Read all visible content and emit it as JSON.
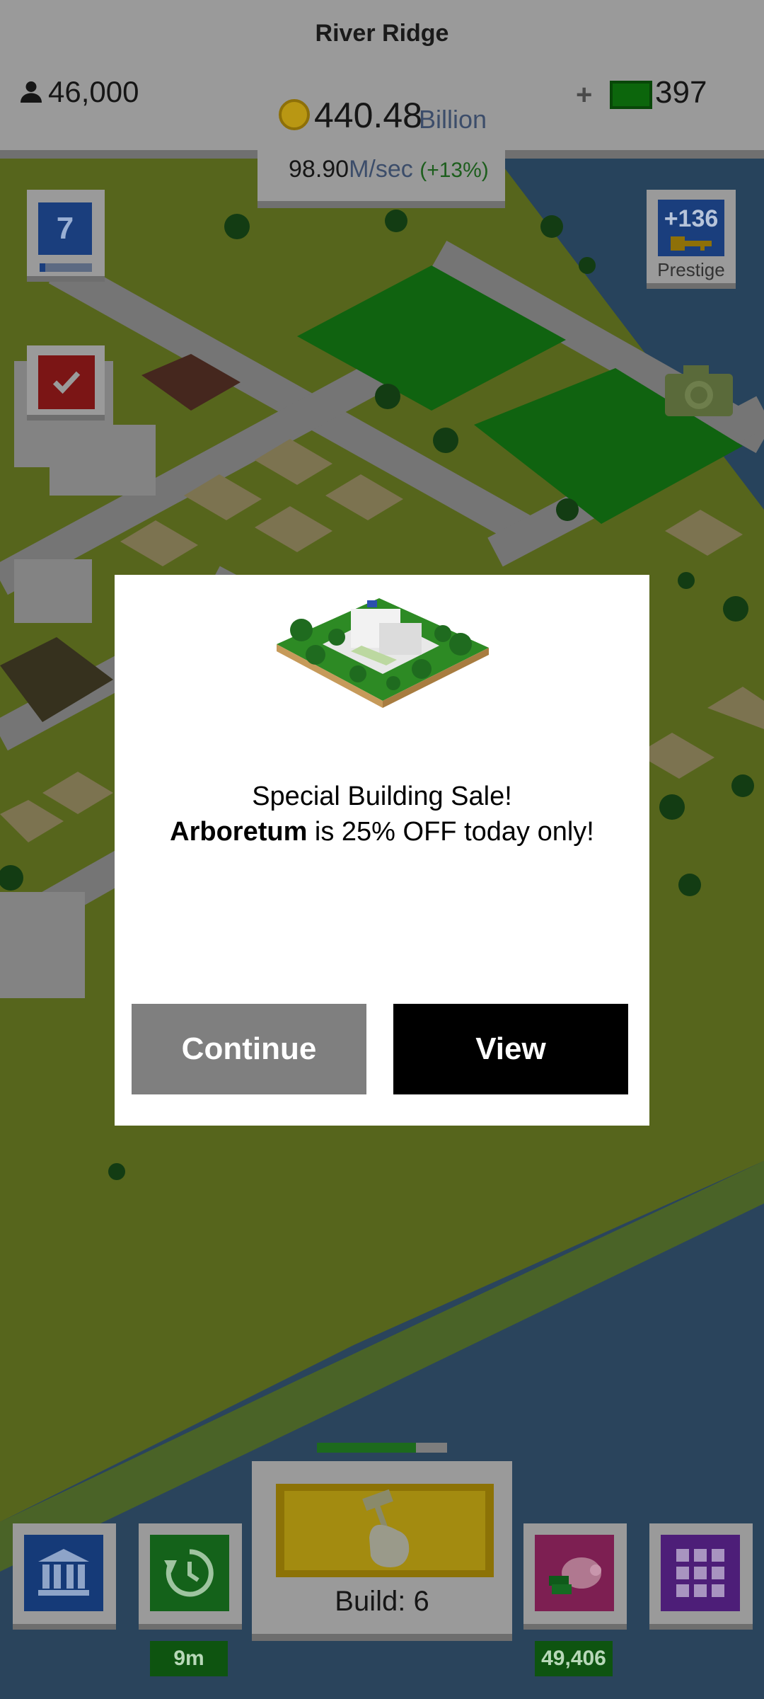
{
  "hud": {
    "city_name": "River Ridge",
    "population": "46,000",
    "cash_value": "440.48",
    "cash_unit": "Billion",
    "rate_value": "98.90",
    "rate_unit": "M/sec",
    "rate_bonus": "(+13%)",
    "plus_symbol": "+",
    "bills": "397"
  },
  "side": {
    "level": "7",
    "prestige_value": "+136",
    "prestige_label": "Prestige"
  },
  "dialog": {
    "title": "Special Building Sale!",
    "building_name": "Arboretum",
    "offer_text": " is 25% OFF today only!",
    "continue_label": "Continue",
    "view_label": "View"
  },
  "bottom": {
    "build_label": "Build: 6",
    "build_progress": 0.76,
    "timer_label": "9m",
    "piggy_label": "49,406"
  },
  "colors": {
    "overlay": "#000000",
    "grass": "#5e6e1e",
    "road": "#8a8a8a",
    "water": "#2c4a66",
    "accent_green": "#14621a",
    "accent_blue": "#153a78"
  }
}
